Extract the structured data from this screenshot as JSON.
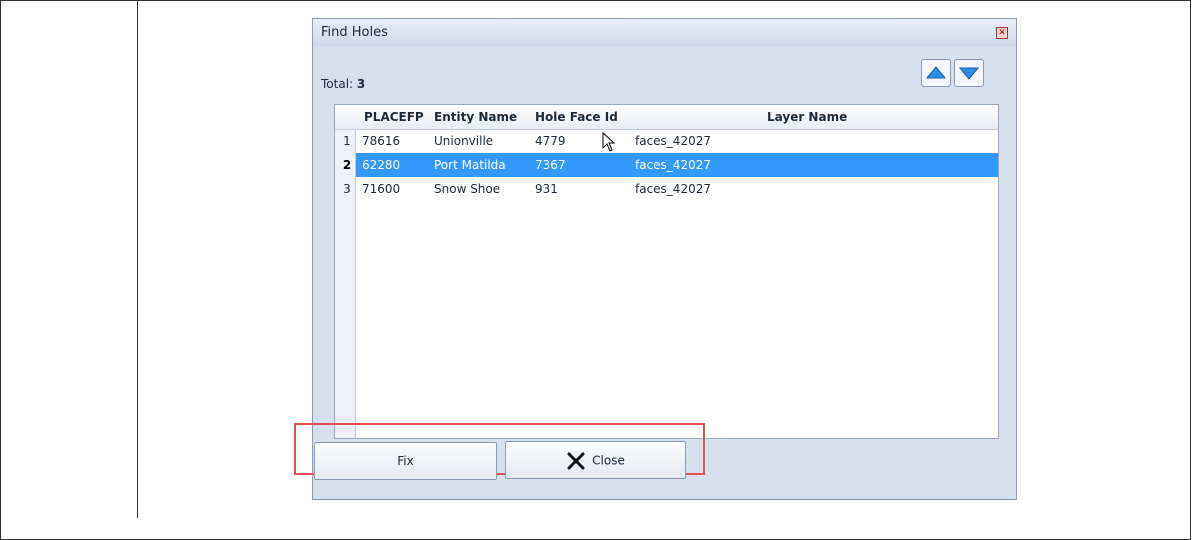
{
  "dialog": {
    "title": "Find Holes",
    "close_glyph": "✕",
    "total_label": "Total:",
    "total_value": "3"
  },
  "nav": {
    "up_icon": "arrow-up-icon",
    "down_icon": "arrow-down-icon"
  },
  "table": {
    "columns": [
      "PLACEFP",
      "Entity Name",
      "Hole Face Id",
      "Layer Name"
    ],
    "rows": [
      {
        "num": "1",
        "placefp": "78616",
        "entity": "Unionville",
        "holeface": "4779",
        "layer": "faces_42027"
      },
      {
        "num": "2",
        "placefp": "62280",
        "entity": "Port Matilda",
        "holeface": "7367",
        "layer": "faces_42027"
      },
      {
        "num": "3",
        "placefp": "71600",
        "entity": "Snow Shoe",
        "holeface": "931",
        "layer": "faces_42027"
      }
    ],
    "selected_row": 2
  },
  "buttons": {
    "fix": "Fix",
    "close": "Close"
  },
  "colors": {
    "selection": "#3399ff",
    "highlight_box": "#e05050"
  }
}
